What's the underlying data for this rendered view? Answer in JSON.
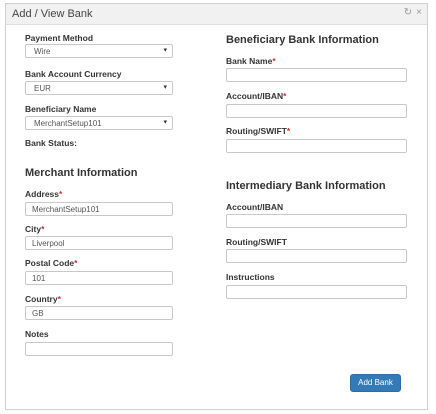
{
  "dialog": {
    "title": "Add / View Bank",
    "refresh_icon": "↻",
    "close_icon": "×"
  },
  "left": {
    "payment_method": {
      "label": "Payment Method",
      "value": "Wire"
    },
    "bank_account_currency": {
      "label": "Bank Account Currency",
      "value": "EUR"
    },
    "beneficiary_name": {
      "label": "Beneficiary Name",
      "value": "MerchantSetup101"
    },
    "bank_status": {
      "label": "Bank Status:"
    },
    "merchant_section_title": "Merchant Information",
    "address": {
      "label": "Address",
      "value": "MerchantSetup101"
    },
    "city": {
      "label": "City",
      "value": "Liverpool"
    },
    "postal_code": {
      "label": "Postal Code",
      "value": "101"
    },
    "country": {
      "label": "Country",
      "value": "GB"
    },
    "notes": {
      "label": "Notes",
      "value": ""
    },
    "required_marker": "*"
  },
  "right": {
    "beneficiary_section_title": "Beneficiary Bank Information",
    "bank_name": {
      "label": "Bank Name",
      "value": ""
    },
    "account_iban": {
      "label": "Account/IBAN",
      "value": ""
    },
    "routing_swift": {
      "label": "Routing/SWIFT",
      "value": ""
    },
    "intermediary_section_title": "Intermediary Bank Information",
    "int_account_iban": {
      "label": "Account/IBAN",
      "value": ""
    },
    "int_routing_swift": {
      "label": "Routing/SWIFT",
      "value": ""
    },
    "instructions": {
      "label": "Instructions",
      "value": ""
    }
  },
  "actions": {
    "add_bank_label": "Add Bank"
  },
  "colors": {
    "primary": "#337ab7",
    "required": "#c9302c"
  }
}
